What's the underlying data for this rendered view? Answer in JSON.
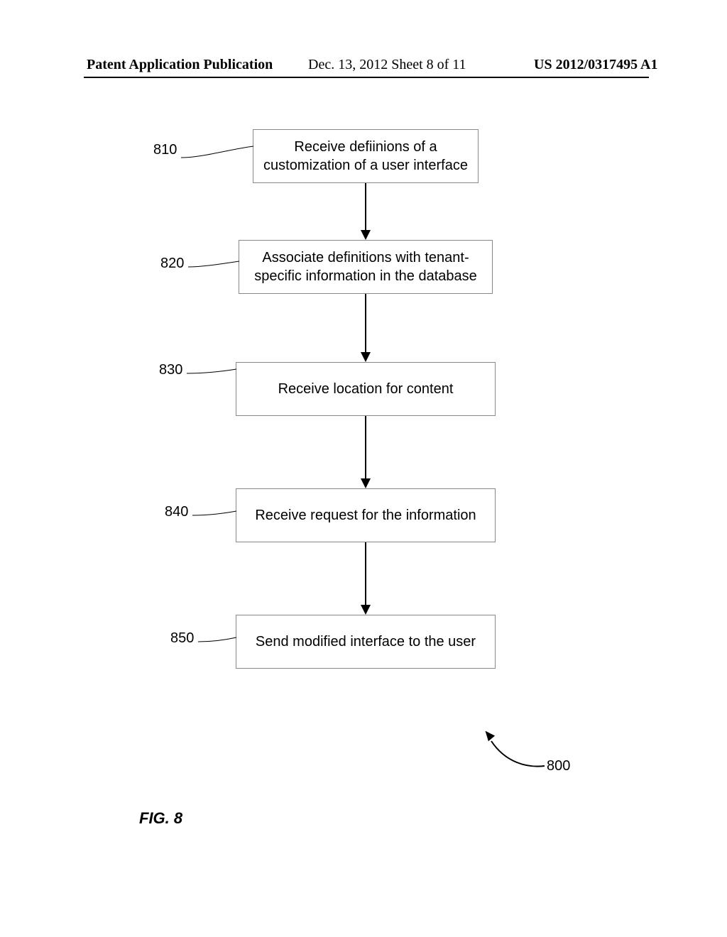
{
  "header": {
    "left": "Patent Application Publication",
    "mid": "Dec. 13, 2012  Sheet 8 of 11",
    "right": "US 2012/0317495 A1"
  },
  "steps": [
    {
      "ref": "810",
      "text": "Receive defiinions of a customization of a user interface"
    },
    {
      "ref": "820",
      "text": "Associate definitions with tenant-specific information in the database"
    },
    {
      "ref": "830",
      "text": "Receive location for content"
    },
    {
      "ref": "840",
      "text": "Receive request for the information"
    },
    {
      "ref": "850",
      "text": "Send modified interface to the user"
    }
  ],
  "figure_ref": "800",
  "figure_label": "FIG. 8"
}
